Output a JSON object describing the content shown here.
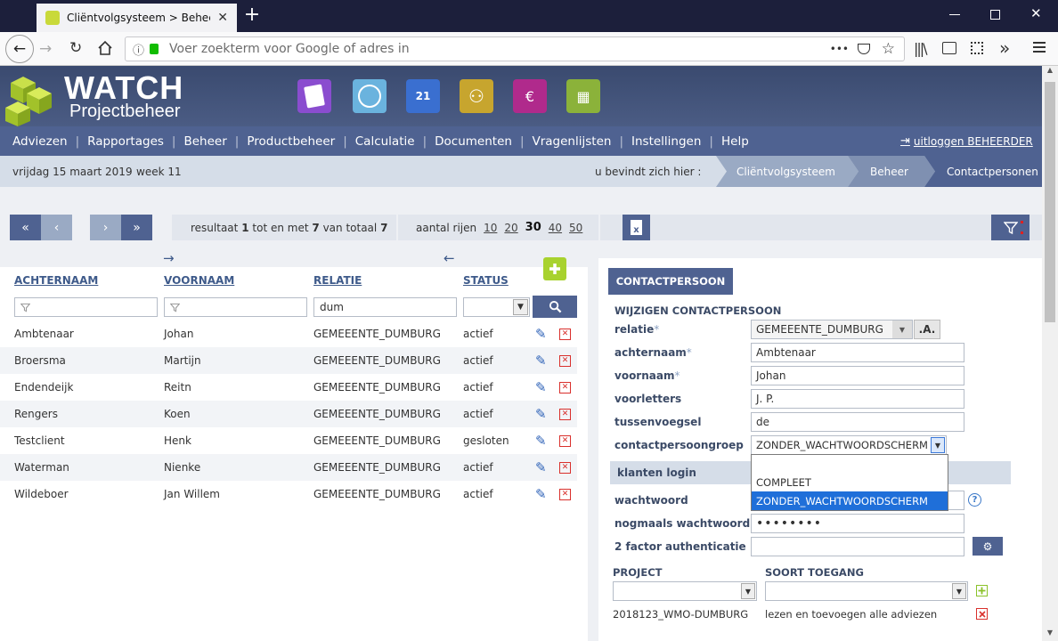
{
  "browser": {
    "tab_title": "Cliëntvolgsysteem > Beheer > C",
    "new_tab": "+",
    "url_placeholder": "Voer zoekterm voor Google of adres in",
    "dots": "•••"
  },
  "app": {
    "logo_title": "WATCH",
    "logo_subtitle": "Projectbeheer",
    "nav": [
      "Adviezen",
      "Rapportages",
      "Beheer",
      "Productbeheer",
      "Calculatie",
      "Documenten",
      "Vragenlijsten",
      "Instellingen",
      "Help"
    ],
    "logout": "uitloggen BEHEERDER",
    "date": "vrijdag 15 maart 2019",
    "week": "week 11",
    "you_are_here": "u bevindt zich hier :",
    "breadcrumbs": [
      "Cliëntvolgsysteem",
      "Beheer",
      "Contactpersonen"
    ]
  },
  "toolbar": {
    "result_pre": "resultaat",
    "result_from": "1",
    "result_mid": "tot en met",
    "result_to": "7",
    "result_of": "van totaal",
    "result_total": "7",
    "rows_label": "aantal rijen",
    "rows_options": [
      "10",
      "20",
      "30",
      "40",
      "50"
    ],
    "rows_selected": "30"
  },
  "list": {
    "columns": [
      "ACHTERNAAM",
      "VOORNAAM",
      "RELATIE",
      "STATUS"
    ],
    "filter_relatie": "dum",
    "rows": [
      {
        "achternaam": "Ambtenaar",
        "voornaam": "Johan",
        "relatie": "GEMEEENTE_DUMBURG",
        "status": "actief"
      },
      {
        "achternaam": "Broersma",
        "voornaam": "Martijn",
        "relatie": "GEMEEENTE_DUMBURG",
        "status": "actief"
      },
      {
        "achternaam": "Endendeijk",
        "voornaam": "Reitn",
        "relatie": "GEMEEENTE_DUMBURG",
        "status": "actief"
      },
      {
        "achternaam": "Rengers",
        "voornaam": "Koen",
        "relatie": "GEMEEENTE_DUMBURG",
        "status": "actief"
      },
      {
        "achternaam": "Testclient",
        "voornaam": "Henk",
        "relatie": "GEMEEENTE_DUMBURG",
        "status": "gesloten"
      },
      {
        "achternaam": "Waterman",
        "voornaam": "Nienke",
        "relatie": "GEMEEENTE_DUMBURG",
        "status": "actief"
      },
      {
        "achternaam": "Wildeboer",
        "voornaam": "Jan Willem",
        "relatie": "GEMEEENTE_DUMBURG",
        "status": "actief"
      }
    ]
  },
  "form": {
    "tab": "CONTACTPERSOON",
    "section": "WIJZIGEN CONTACTPERSOON",
    "relatie_label": "relatie",
    "relatie_value": "GEMEEENTE_DUMBURG",
    "relatie_btn": ".A.",
    "achternaam_label": "achternaam",
    "achternaam_value": "Ambtenaar",
    "voornaam_label": "voornaam",
    "voornaam_value": "Johan",
    "voorletters_label": "voorletters",
    "voorletters_value": "J. P.",
    "tussenvoegsel_label": "tussenvoegsel",
    "tussenvoegsel_value": "de",
    "groep_label": "contactpersoongroep",
    "groep_value": "ZONDER_WACHTWOORDSCHERM",
    "groep_options": [
      "",
      "COMPLEET",
      "ZONDER_WACHTWOORDSCHERM"
    ],
    "login_section": "klanten login",
    "wachtwoord_label": "wachtwoord",
    "nogmaals_label": "nogmaals wachtwoord",
    "nogmaals_value": "••••••••",
    "twofa_label": "2 factor authenticatie",
    "project_head": "PROJECT",
    "toegang_head": "SOORT TOEGANG",
    "project_row": "2018123_WMO-DUMBURG",
    "toegang_row": "lezen en toevoegen alle adviezen",
    "asterisk": "*"
  },
  "colors": {
    "accent": "#4f6291",
    "header": "#3e4e75",
    "logo_green": "#a8d22e",
    "delete_red": "#d9302c"
  }
}
